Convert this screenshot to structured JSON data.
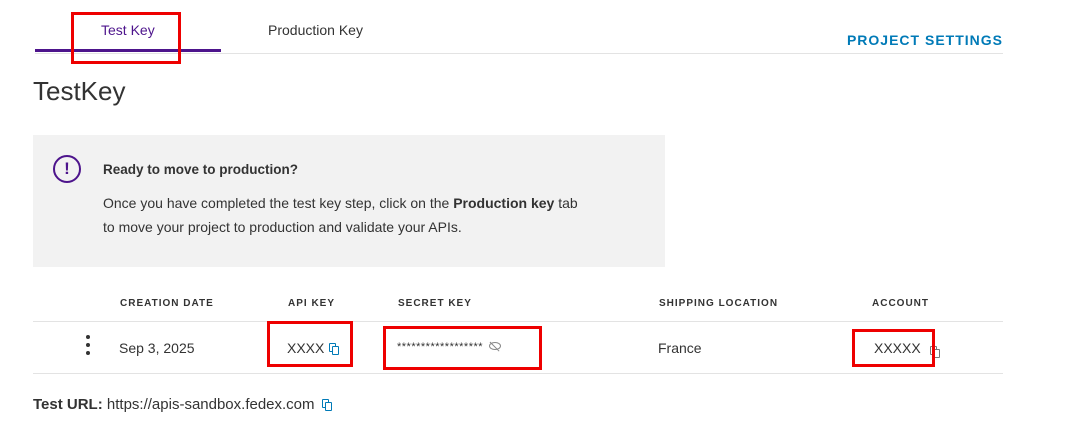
{
  "tabs": [
    {
      "label": "Test Key",
      "active": true
    },
    {
      "label": "Production Key",
      "active": false
    }
  ],
  "project_settings_label": "PROJECT SETTINGS",
  "page_title": "TestKey",
  "notice": {
    "icon": "exclamation-circle-icon",
    "title": "Ready to move to production?",
    "body_prefix": "Once you have completed the test key step, click on the ",
    "body_bold": "Production key",
    "body_suffix": " tab to move your project to production and validate your APIs."
  },
  "table": {
    "headers": [
      "CREATION DATE",
      "API KEY",
      "SECRET KEY",
      "SHIPPING LOCATION",
      "ACCOUNT"
    ],
    "row": {
      "creation_date": "Sep 3, 2025",
      "api_key": "XXXX",
      "secret_key": "******************",
      "shipping_location": "France",
      "account": "XXXXX"
    }
  },
  "test_url": {
    "label": "Test URL:",
    "value": "https://apis-sandbox.fedex.com"
  },
  "colors": {
    "brand_purple": "#4d148c",
    "link_blue": "#007ab7",
    "highlight_red": "#ee0000"
  }
}
